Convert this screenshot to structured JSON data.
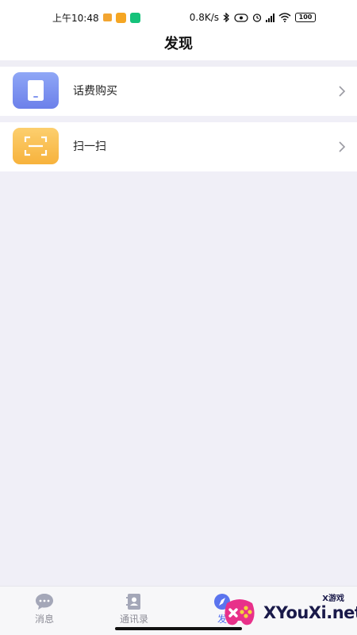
{
  "status_bar": {
    "time": "上午10:48",
    "net_speed": "0.8K/s",
    "battery": "100"
  },
  "header": {
    "title": "发现"
  },
  "entries": [
    {
      "label": "话费购买",
      "icon": "phone-card-icon"
    },
    {
      "label": "扫一扫",
      "icon": "scan-icon"
    }
  ],
  "tabs": [
    {
      "label": "消息",
      "icon": "chat-bubble-icon"
    },
    {
      "label": "通讯录",
      "icon": "contacts-book-icon"
    },
    {
      "label": "发",
      "icon": "compass-icon"
    }
  ],
  "watermark": {
    "text": "XYouXi.net",
    "small": "X游戏"
  },
  "colors": {
    "accent": "#4d6bf0",
    "phone_icon": "#7c92f1",
    "scan_icon": "#f9c14f",
    "background": "#f0eff7"
  }
}
